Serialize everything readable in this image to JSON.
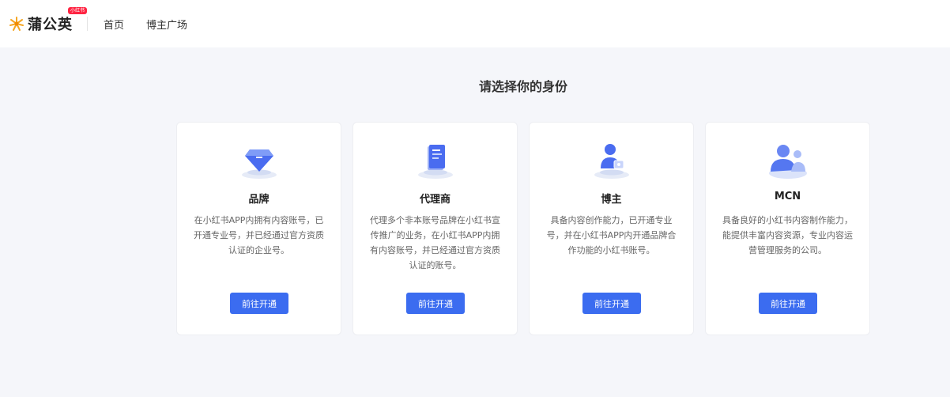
{
  "header": {
    "logo_text": "蒲公英",
    "logo_badge": "小红书",
    "nav": [
      {
        "label": "首页"
      },
      {
        "label": "博主广场"
      }
    ]
  },
  "main": {
    "title": "请选择你的身份",
    "cards": [
      {
        "icon": "diamond-icon",
        "title": "品牌",
        "description": "在小红书APP内拥有内容账号，已开通专业号，并已经通过官方资质认证的企业号。",
        "button": "前往开通"
      },
      {
        "icon": "document-icon",
        "title": "代理商",
        "description": "代理多个非本账号品牌在小红书宣传推广的业务，在小红书APP内拥有内容账号，并已经通过官方资质认证的账号。",
        "button": "前往开通"
      },
      {
        "icon": "user-badge-icon",
        "title": "博主",
        "description": "具备内容创作能力，已开通专业号，并在小红书APP内开通品牌合作功能的小红书账号。",
        "button": "前往开通"
      },
      {
        "icon": "group-icon",
        "title": "MCN",
        "description": "具备良好的小红书内容制作能力，能提供丰富内容资源，专业内容运营管理服务的公司。",
        "button": "前往开通"
      }
    ]
  },
  "colors": {
    "accent": "#3b6cf0",
    "brand_badge": "#ff2442",
    "logo_icon": "#f5a623",
    "background": "#f5f6fa"
  }
}
